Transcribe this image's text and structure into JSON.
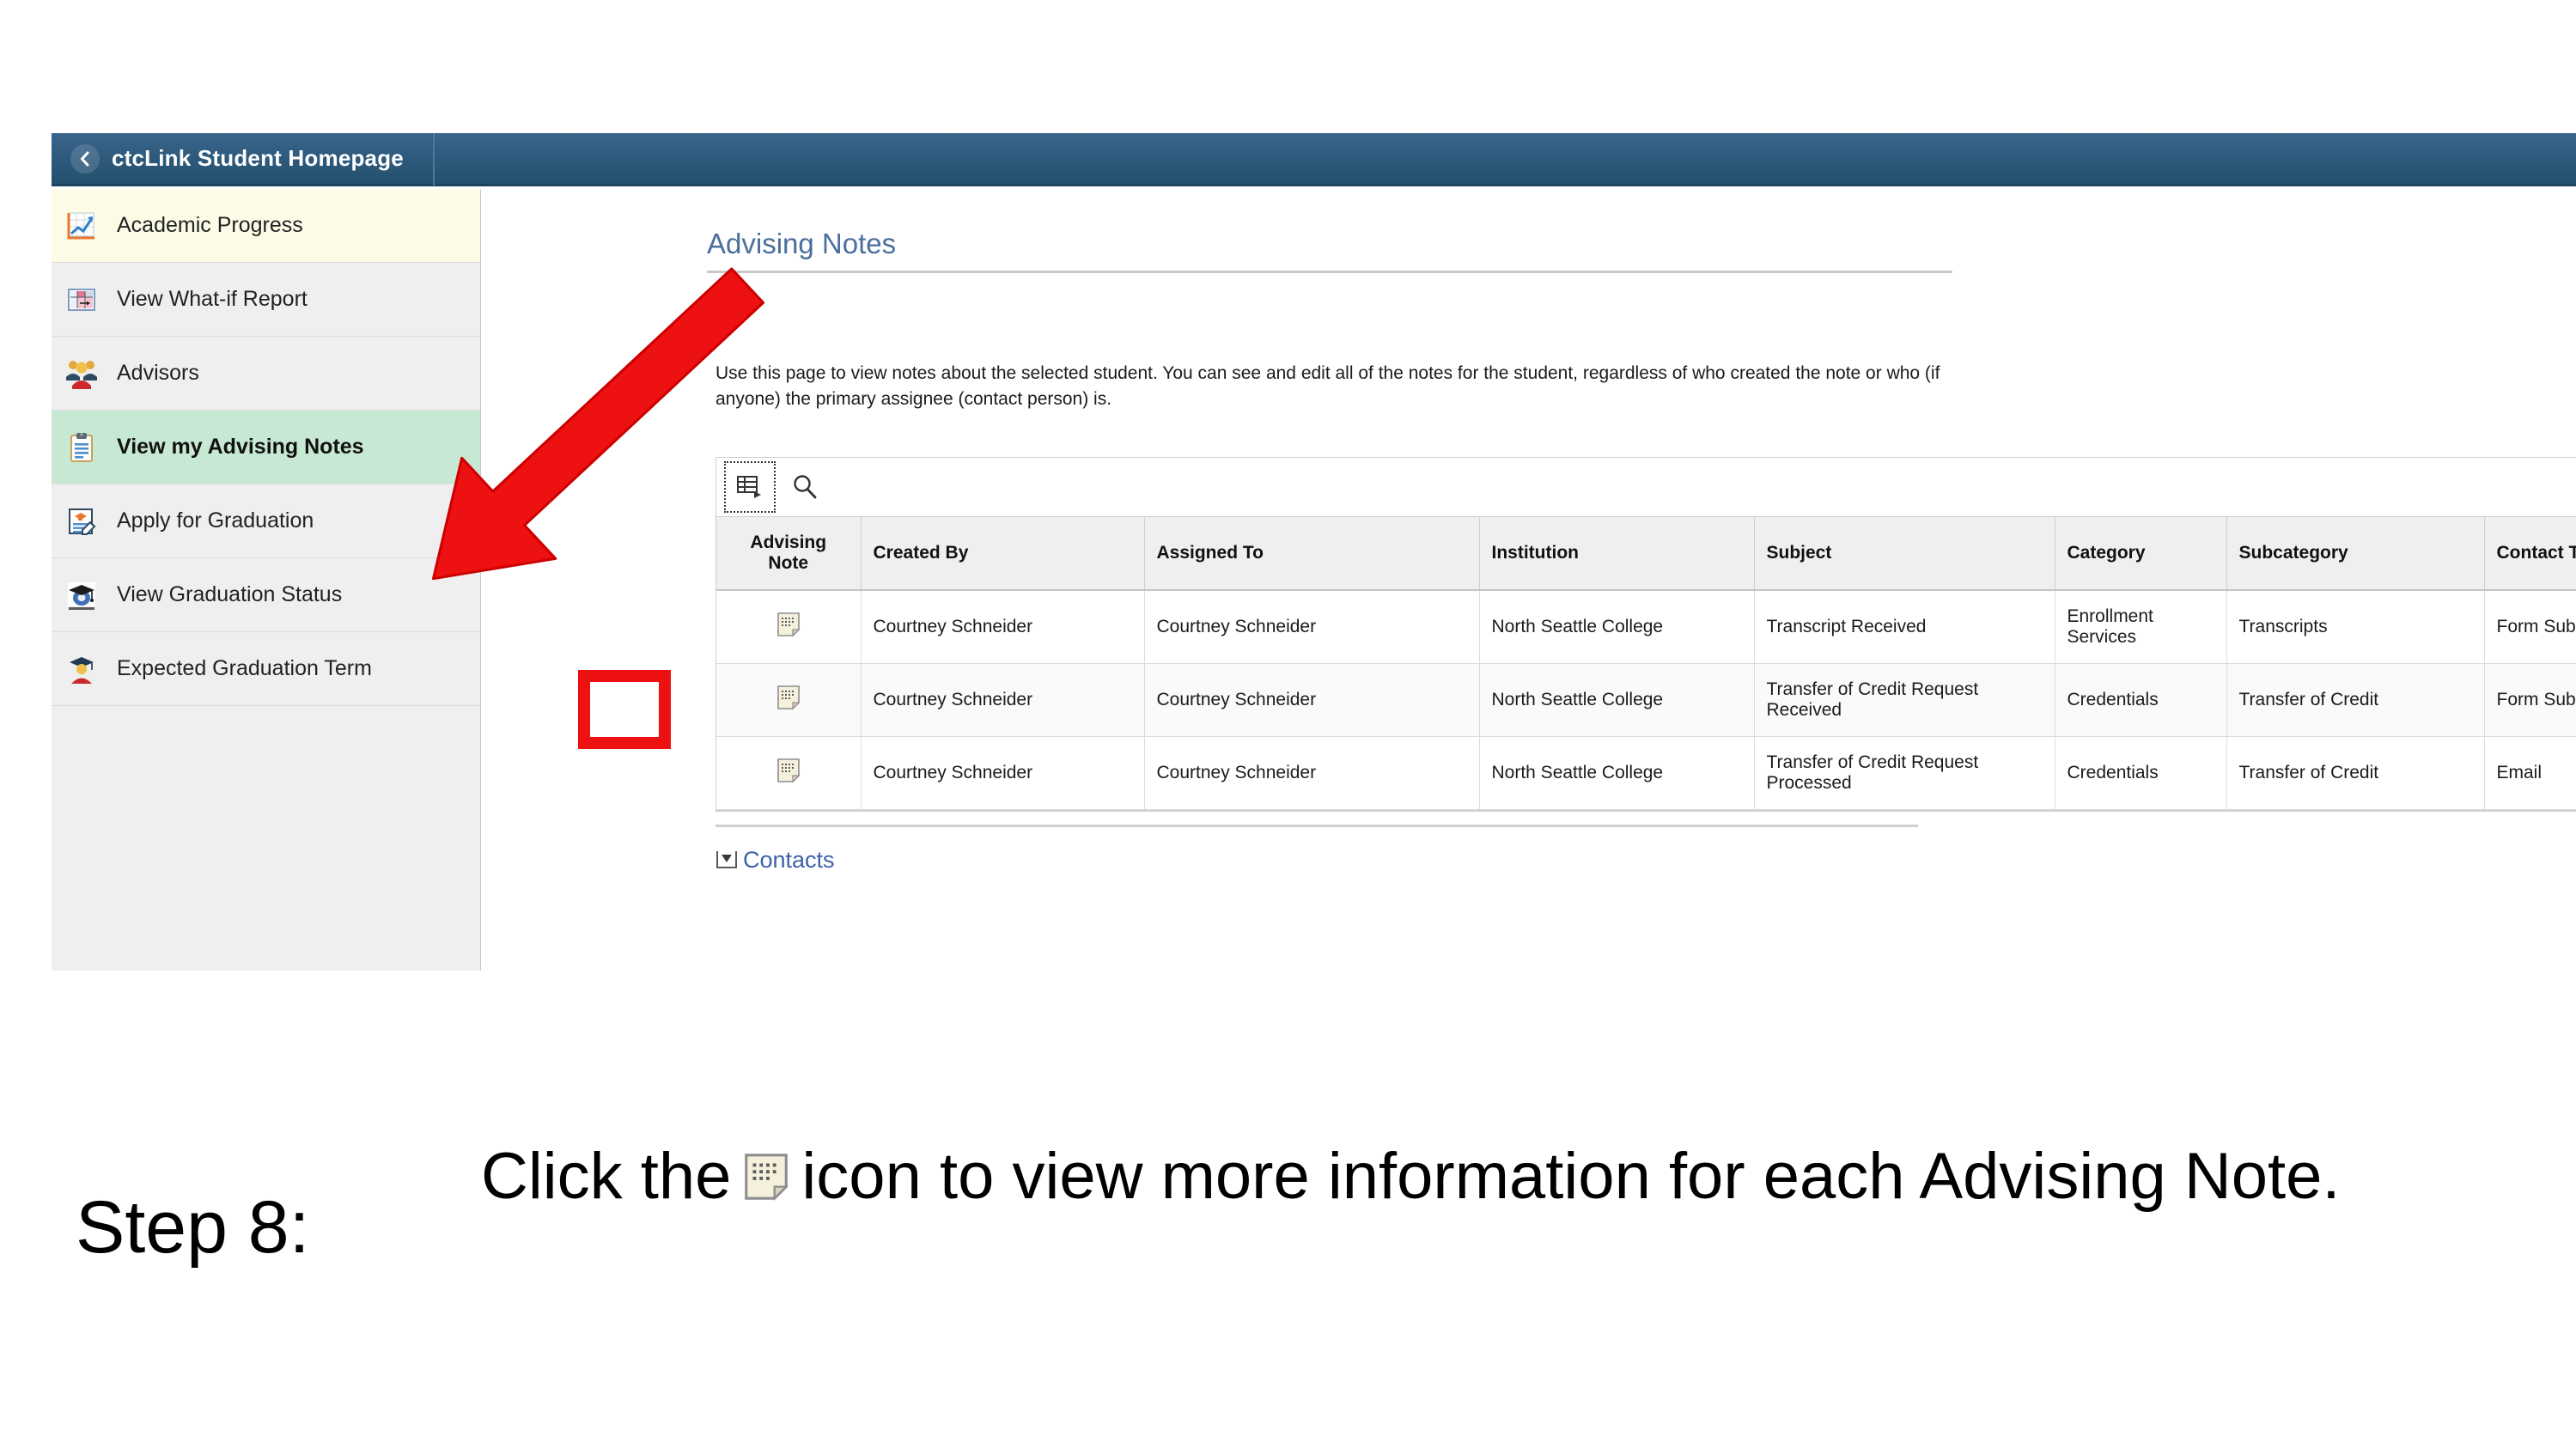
{
  "header": {
    "back_icon": "chevron-left-icon",
    "title": "ctcLink Student Homepage"
  },
  "sidebar": {
    "items": [
      {
        "label": "Academic Progress",
        "icon": "line-chart-icon",
        "selected": false,
        "state": "visited"
      },
      {
        "label": "View What-if Report",
        "icon": "what-if-report-icon",
        "selected": false,
        "state": "normal"
      },
      {
        "label": "Advisors",
        "icon": "people-group-icon",
        "selected": false,
        "state": "normal"
      },
      {
        "label": "View my Advising Notes",
        "icon": "clipboard-notes-icon",
        "selected": true,
        "state": "normal"
      },
      {
        "label": "Apply for Graduation",
        "icon": "application-form-icon",
        "selected": false,
        "state": "normal"
      },
      {
        "label": "View Graduation Status",
        "icon": "grad-cap-disc-icon",
        "selected": false,
        "state": "normal"
      },
      {
        "label": "Expected Graduation Term",
        "icon": "graduate-person-icon",
        "selected": false,
        "state": "normal"
      }
    ]
  },
  "main": {
    "page_title": "Advising Notes",
    "intro_text": "Use this page to view notes about the selected student. You can see and edit all of the notes for the student, regardless of who created the note or who (if anyone) the primary assignee (contact person) is.",
    "toolbar": {
      "grid_personalize_label": "grid-personalize-icon",
      "search_label": "search-icon"
    },
    "grid": {
      "columns": [
        "Advising Note",
        "Created By",
        "Assigned To",
        "Institution",
        "Subject",
        "Category",
        "Subcategory",
        "Contact Type"
      ],
      "rows": [
        {
          "note_icon": "advising-note-icon",
          "created_by": "Courtney Schneider",
          "assigned_to": "Courtney Schneider",
          "institution": "North Seattle College",
          "subject": "Transcript Received",
          "category": "Enrollment Services",
          "subcategory": "Transcripts",
          "contact_type": "Form Submitted"
        },
        {
          "note_icon": "advising-note-icon",
          "created_by": "Courtney Schneider",
          "assigned_to": "Courtney Schneider",
          "institution": "North Seattle College",
          "subject": "Transfer of Credit Request Received",
          "category": "Credentials",
          "subcategory": "Transfer of Credit",
          "contact_type": "Form Submitted"
        },
        {
          "note_icon": "advising-note-icon",
          "created_by": "Courtney Schneider",
          "assigned_to": "Courtney Schneider",
          "institution": "North Seattle College",
          "subject": "Transfer of Credit Request Processed",
          "category": "Credentials",
          "subcategory": "Transfer of Credit",
          "contact_type": "Email"
        }
      ]
    },
    "contacts_section": {
      "label": "Contacts",
      "toggle_icon": "collapse-triangle-icon"
    }
  },
  "annotations": {
    "arrow": {
      "icon": "red-callout-arrow",
      "color": "#ee1111"
    },
    "highlight_box": {
      "color": "#ee1111"
    }
  },
  "caption": {
    "step_label": "Step 8:",
    "body_before_icon": "Click the",
    "inline_icon": "advising-note-icon",
    "body_after_icon": "icon to view more information for each Advising Note."
  },
  "colors": {
    "header_bar": "#2e5a7d",
    "sidebar_bg": "#efefef",
    "sidebar_selected": "#c7e8d3",
    "sidebar_visited": "#fbfbe6",
    "heading_blue": "#4a6f9c",
    "link_blue": "#3a63a8",
    "annotation_red": "#ee1111"
  }
}
